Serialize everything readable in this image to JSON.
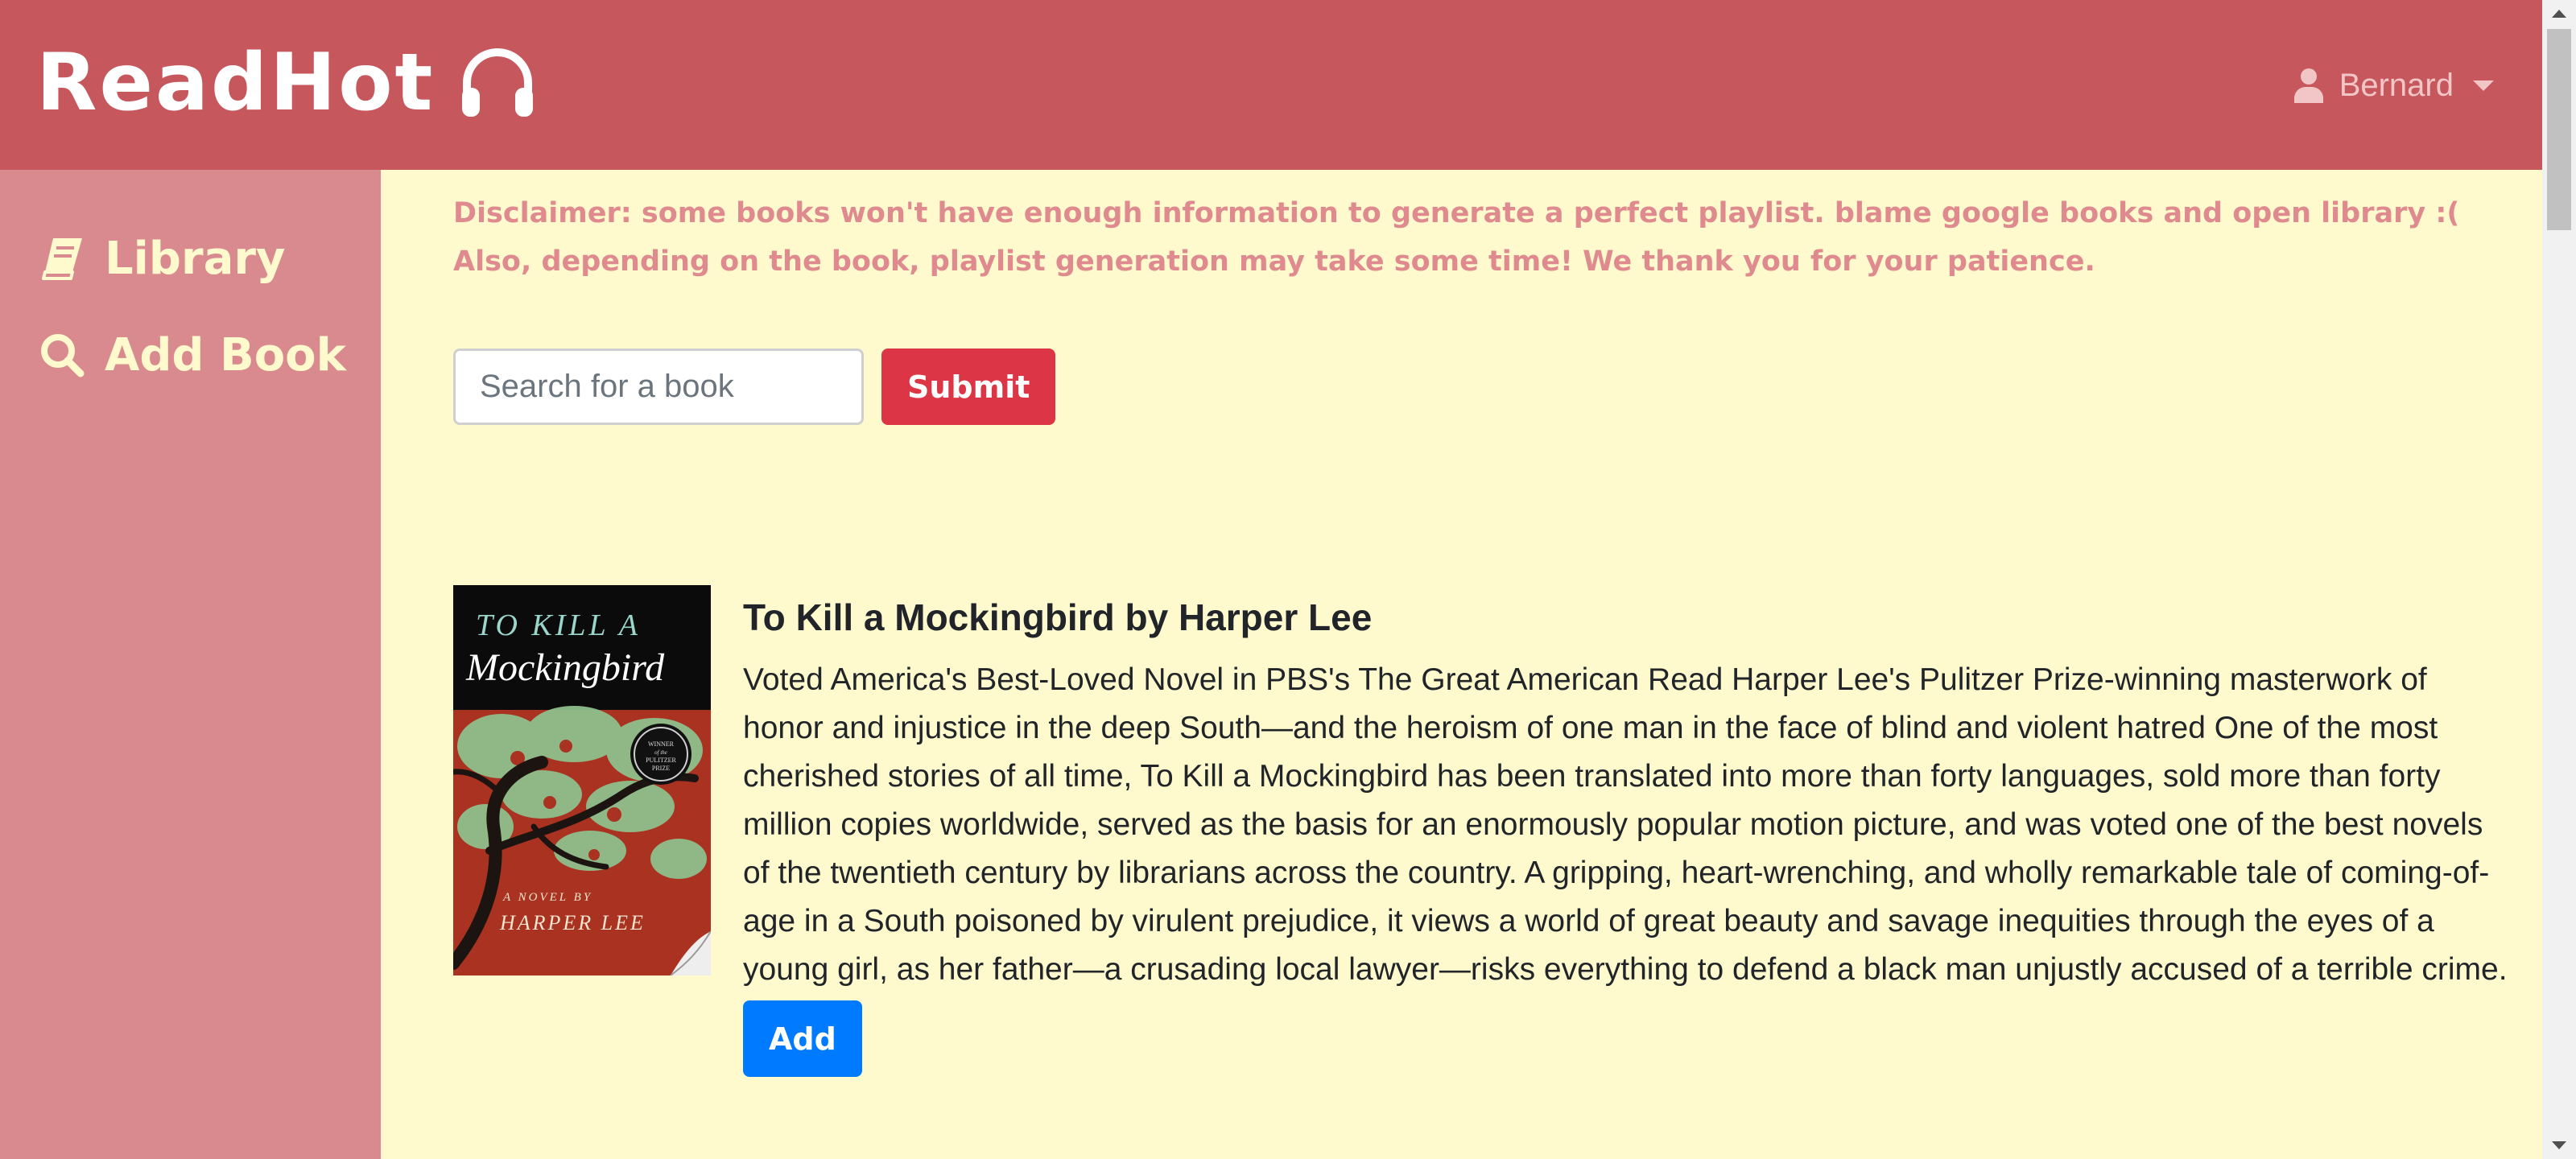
{
  "header": {
    "brand": "ReadHot",
    "brand_icon": "headphones-icon",
    "user_icon": "user-icon",
    "user_name": "Bernard",
    "colors": {
      "header_bg": "#c6575c",
      "user_text": "#f2c5c7"
    }
  },
  "sidebar": {
    "items": [
      {
        "label": "Library",
        "icon": "book-icon"
      },
      {
        "label": "Add Book",
        "icon": "search-icon"
      }
    ],
    "colors": {
      "bg": "#d98a8f",
      "text": "#fffacd"
    }
  },
  "main": {
    "disclaimer_lines": [
      "Disclaimer: some books won't have enough information to generate a perfect playlist. blame google books and open library :(",
      "Also, depending on the book, playlist generation may take some time! We thank you for your patience."
    ],
    "search": {
      "placeholder": "Search for a book",
      "value": ""
    },
    "submit_label": "Submit",
    "results": [
      {
        "title": "To Kill a Mockingbird by Harper Lee",
        "cover_title_line1": "TO KILL A",
        "cover_title_line2": "Mockingbird",
        "cover_byline_line1": "A NOVEL BY",
        "cover_byline_line2": "HARPER LEE",
        "cover_seal_line1": "WINNER",
        "cover_seal_line2": "of the",
        "cover_seal_line3": "PULITZER",
        "cover_seal_line4": "PRIZE",
        "description": "Voted America's Best-Loved Novel in PBS's The Great American Read Harper Lee's Pulitzer Prize-winning masterwork of honor and injustice in the deep South—and the heroism of one man in the face of blind and violent hatred One of the most cherished stories of all time, To Kill a Mockingbird has been translated into more than forty languages, sold more than forty million copies worldwide, served as the basis for an enormously popular motion picture, and was voted one of the best novels of the twentieth century by librarians across the country. A gripping, heart-wrenching, and wholly remarkable tale of coming-of-age in a South poisoned by virulent prejudice, it views a world of great beauty and savage inequities through the eyes of a young girl, as her father—a crusading local lawyer—risks everything to defend a black man unjustly accused of a terrible crime.",
        "add_label": "Add"
      }
    ],
    "colors": {
      "bg": "#fffacd",
      "disclaimer_text": "#df8a8f",
      "submit_button": "#dc3545",
      "add_button": "#007bff"
    }
  }
}
